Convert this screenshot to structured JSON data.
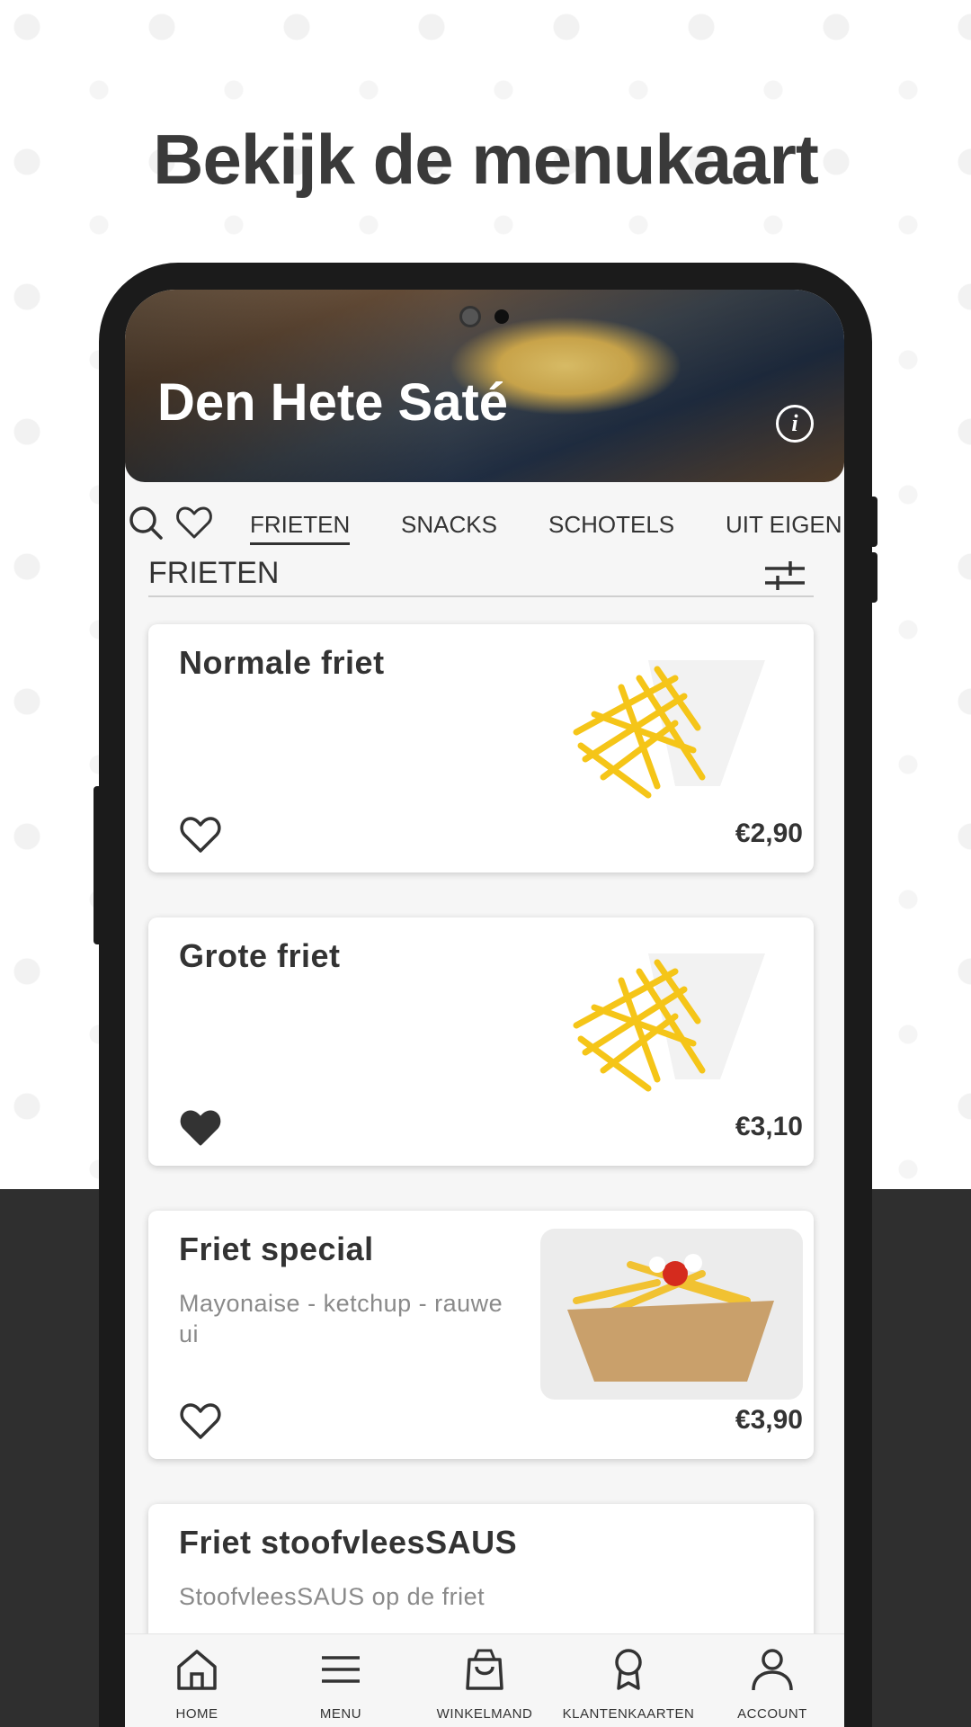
{
  "promo": {
    "title": "Bekijk de menukaart"
  },
  "restaurant": {
    "name": "Den Hete Saté",
    "info_icon": "info-icon"
  },
  "tabs": [
    "FRIETEN",
    "SNACKS",
    "SCHOTELS",
    "UIT EIGEN"
  ],
  "active_tab": "FRIETEN",
  "section": {
    "title": "FRIETEN"
  },
  "items": [
    {
      "name": "Normale friet",
      "description": "",
      "price": "€2,90",
      "favorite": false
    },
    {
      "name": "Grote friet",
      "description": "",
      "price": "€3,10",
      "favorite": true
    },
    {
      "name": "Friet special",
      "description": "Mayonaise - ketchup - rauwe ui",
      "price": "€3,90",
      "favorite": false
    },
    {
      "name": "Friet stoofvleesSAUS",
      "description": "StoofvleesSAUS op de friet",
      "price": "",
      "favorite": false
    }
  ],
  "bottom_nav": [
    {
      "label": "HOME",
      "icon": "home-icon"
    },
    {
      "label": "MENU",
      "icon": "menu-icon"
    },
    {
      "label": "WINKELMAND",
      "icon": "shopping-bag-icon"
    },
    {
      "label": "KLANTENKAARTEN",
      "icon": "award-icon"
    },
    {
      "label": "ACCOUNT",
      "icon": "user-icon"
    }
  ],
  "colors": {
    "accent": "#333333",
    "footer_bg": "#2f2f2f",
    "screen_bg": "#f6f6f6"
  }
}
